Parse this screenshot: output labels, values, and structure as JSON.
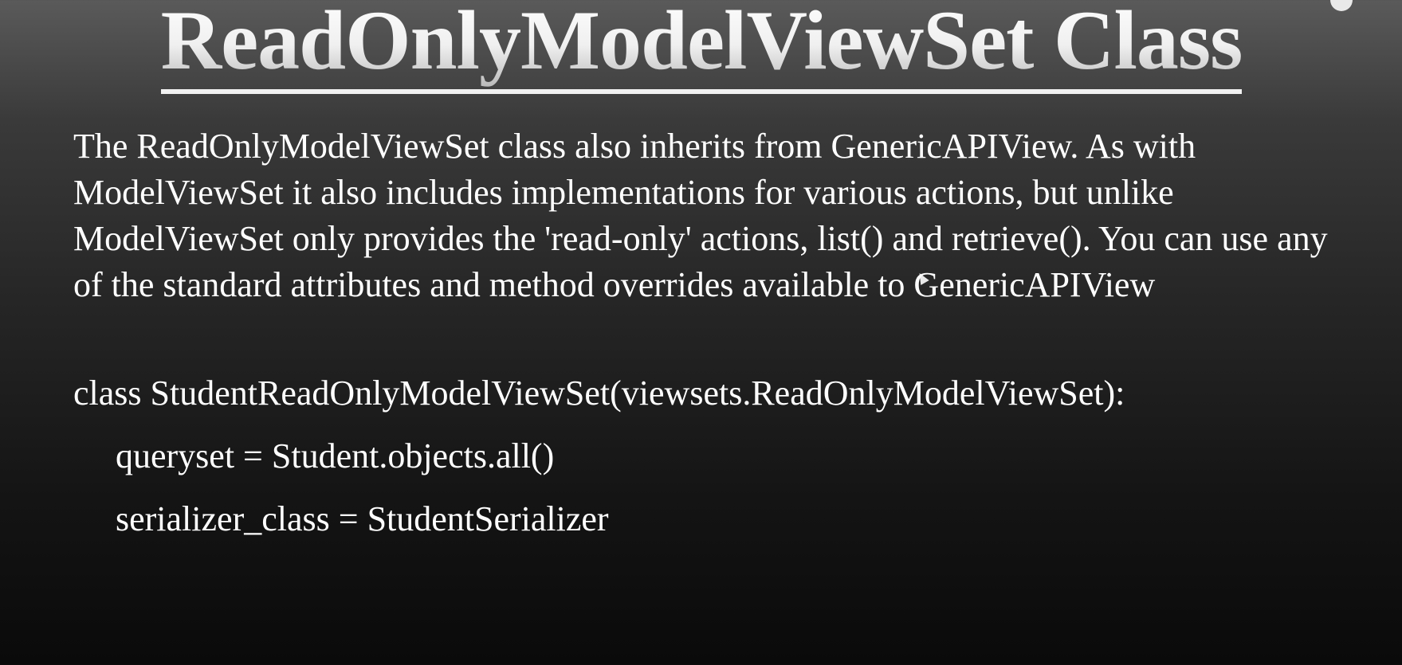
{
  "slide": {
    "title": "ReadOnlyModelViewSet Class",
    "description": "The ReadOnlyModelViewSet class also inherits from GenericAPIView. As with ModelViewSet it also includes implementations for various actions, but unlike ModelViewSet only provides the 'read-only' actions, list() and retrieve(). You can use any of the standard attributes and method overrides available to GenericAPIView",
    "code": {
      "class_line": "class StudentReadOnlyModelViewSet(viewsets.ReadOnlyModelViewSet):",
      "queryset_line": "queryset = Student.objects.all()",
      "serializer_line": "serializer_class = StudentSerializer"
    }
  },
  "colors": {
    "background_top": "#5a5a5a",
    "background_bottom": "#0a0a0a",
    "text": "#ffffff"
  },
  "icons": {
    "cursor": "mouse-cursor-icon"
  }
}
